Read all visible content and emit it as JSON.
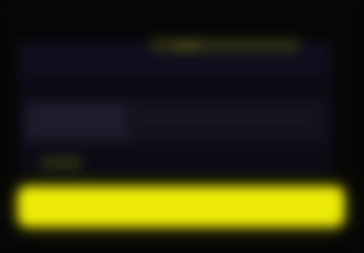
{
  "theme": {
    "background": "#060606",
    "panel": "#0b0b16",
    "accent": "#ecea06"
  },
  "panel": {},
  "button": {}
}
